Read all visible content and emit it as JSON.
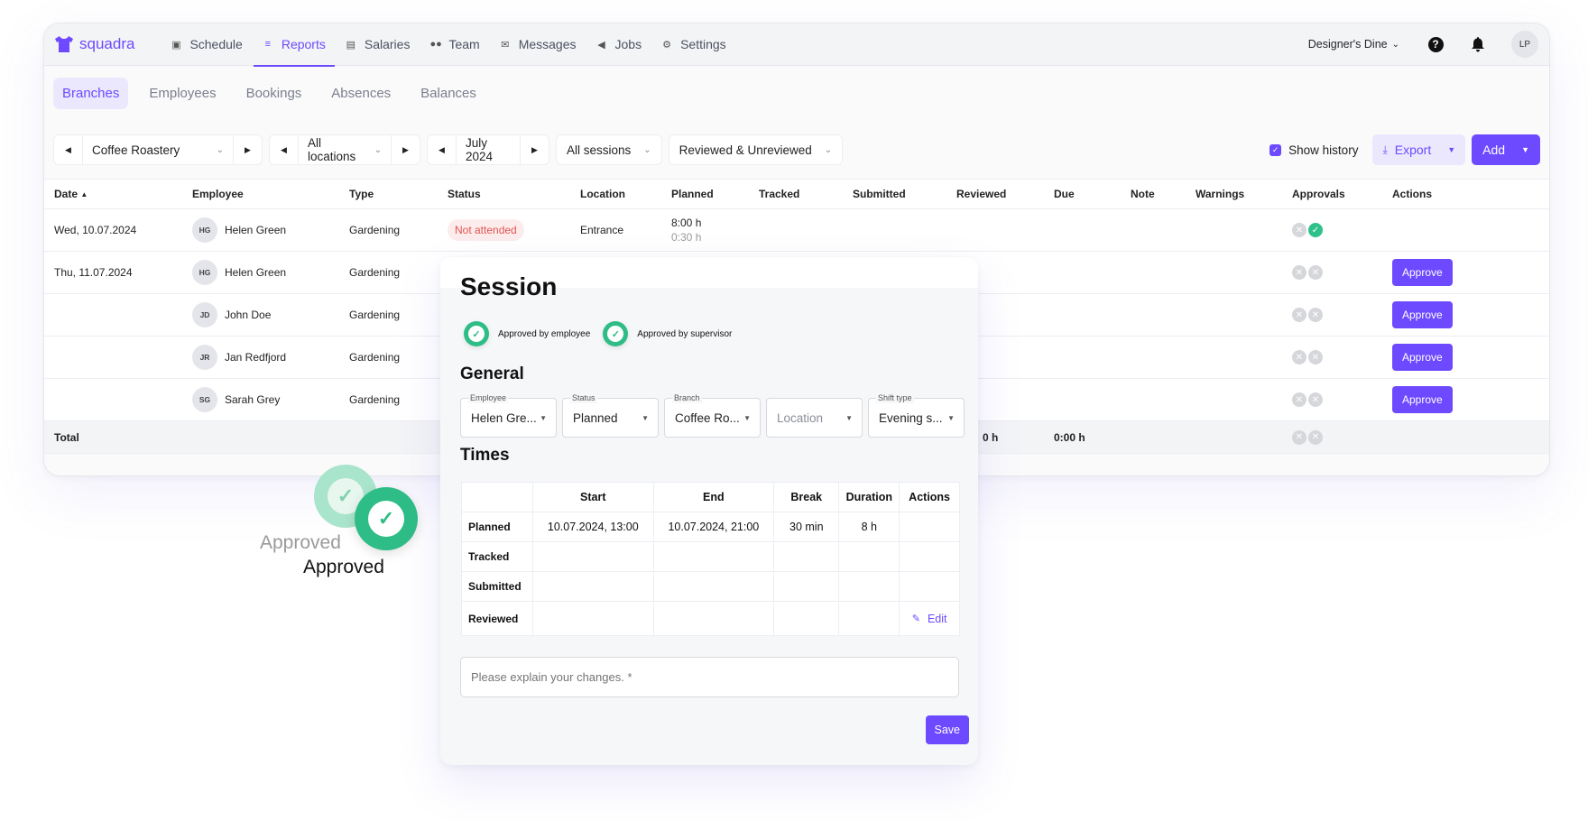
{
  "brand": {
    "name": "squadra",
    "color": "#6d4aff"
  },
  "nav": {
    "items": [
      {
        "label": "Schedule",
        "icon": "calendar-icon",
        "glyph": "▣",
        "active": false
      },
      {
        "label": "Reports",
        "icon": "list-icon",
        "glyph": "≡",
        "active": true
      },
      {
        "label": "Salaries",
        "icon": "salary-icon",
        "glyph": "▤",
        "active": false
      },
      {
        "label": "Team",
        "icon": "team-icon",
        "glyph": "👥",
        "active": false
      },
      {
        "label": "Messages",
        "icon": "mail-icon",
        "glyph": "✉",
        "active": false
      },
      {
        "label": "Jobs",
        "icon": "megaphone-icon",
        "glyph": "📢",
        "active": false
      },
      {
        "label": "Settings",
        "icon": "gear-icon",
        "glyph": "⚙",
        "active": false
      }
    ],
    "org": "Designer's Dine",
    "help_glyph": "?",
    "user_initials": "LP"
  },
  "subtabs": [
    {
      "label": "Branches",
      "active": true
    },
    {
      "label": "Employees",
      "active": false
    },
    {
      "label": "Bookings",
      "active": false
    },
    {
      "label": "Absences",
      "active": false
    },
    {
      "label": "Balances",
      "active": false
    }
  ],
  "filters": {
    "branch": "Coffee Roastery",
    "location": "All locations",
    "month": "July 2024",
    "sessions": "All sessions",
    "review": "Reviewed & Unreviewed",
    "show_history_label": "Show history",
    "show_history_checked": true,
    "export_label": "Export",
    "add_label": "Add"
  },
  "table": {
    "headers": [
      "Date",
      "Employee",
      "Type",
      "Status",
      "Location",
      "Planned",
      "Tracked",
      "Submitted",
      "Reviewed",
      "Due",
      "Note",
      "Warnings",
      "Approvals",
      "Actions"
    ],
    "sort_indicator": "▲",
    "rows": [
      {
        "date": "Wed, 10.07.2024",
        "initials": "HG",
        "employee": "Helen Green",
        "type": "Gardening",
        "status": "Not attended",
        "location": "Entrance",
        "planned": "8:00 h",
        "planned_break": "0:30 h",
        "approvals": [
          "rejected",
          "approved"
        ],
        "action": ""
      },
      {
        "date": "Thu, 11.07.2024",
        "initials": "HG",
        "employee": "Helen Green",
        "type": "Gardening",
        "status": "",
        "location": "",
        "planned": "",
        "planned_break": "",
        "approvals": [
          "rejected",
          "rejected"
        ],
        "action": "Approve"
      },
      {
        "date": "",
        "initials": "JD",
        "employee": "John Doe",
        "type": "Gardening",
        "status": "",
        "location": "",
        "planned": "",
        "planned_break": "",
        "approvals": [
          "rejected",
          "rejected"
        ],
        "action": "Approve"
      },
      {
        "date": "",
        "initials": "JR",
        "employee": "Jan Redfjord",
        "type": "Gardening",
        "status": "",
        "location": "",
        "planned": "",
        "planned_break": "",
        "approvals": [
          "rejected",
          "rejected"
        ],
        "action": "Approve"
      },
      {
        "date": "",
        "initials": "SG",
        "employee": "Sarah Grey",
        "type": "Gardening",
        "status": "",
        "location": "",
        "planned": "",
        "planned_break": "",
        "approvals": [
          "rejected",
          "rejected"
        ],
        "action": "Approve"
      }
    ],
    "total": {
      "label": "Total",
      "reviewed_partial": "0 h",
      "due": "0:00 h"
    }
  },
  "floating": {
    "label_back": "Approved",
    "label_front": "Approved"
  },
  "modal": {
    "title": "Session",
    "approvals": [
      "Approved by employee",
      "Approved by supervisor"
    ],
    "general_heading": "General",
    "fields": [
      {
        "label": "Employee",
        "value": "Helen Gre...",
        "placeholder": false
      },
      {
        "label": "Status",
        "value": "Planned",
        "placeholder": false
      },
      {
        "label": "Branch",
        "value": "Coffee Ro...",
        "placeholder": false
      },
      {
        "label": "",
        "value": "Location",
        "placeholder": true
      },
      {
        "label": "Shift type",
        "value": "Evening s...",
        "placeholder": false
      }
    ],
    "times_heading": "Times",
    "times": {
      "headers": [
        "",
        "Start",
        "End",
        "Break",
        "Duration",
        "Actions"
      ],
      "rows": [
        {
          "label": "Planned",
          "start": "10.07.2024, 13:00",
          "end": "10.07.2024, 21:00",
          "break": "30 min",
          "duration": "8 h",
          "action": ""
        },
        {
          "label": "Tracked",
          "start": "",
          "end": "",
          "break": "",
          "duration": "",
          "action": ""
        },
        {
          "label": "Submitted",
          "start": "",
          "end": "",
          "break": "",
          "duration": "",
          "action": ""
        },
        {
          "label": "Reviewed",
          "start": "",
          "end": "",
          "break": "",
          "duration": "",
          "action": "Edit"
        }
      ]
    },
    "reason_placeholder": "Please explain your changes. *",
    "save_label": "Save"
  }
}
